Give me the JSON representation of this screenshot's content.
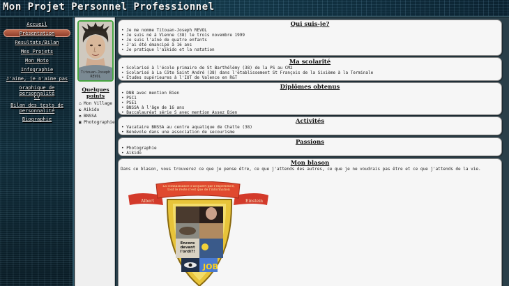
{
  "header": {
    "title": "Mon Projet Personnel Professionnel"
  },
  "nav": {
    "items": [
      {
        "label": "Accueil"
      },
      {
        "label": "Présentation",
        "active": true
      },
      {
        "label": "Resultats/Bilan"
      },
      {
        "label": "Mes Projets"
      },
      {
        "label": "Mon Moto"
      },
      {
        "label": "Infographie"
      },
      {
        "label": "J'aime, je n'aime pas"
      },
      {
        "label": "Graphique de personnalité"
      },
      {
        "label": "CV"
      },
      {
        "label": "Bilan des tests de personnalité"
      },
      {
        "label": "Biographie"
      }
    ]
  },
  "profile": {
    "avatar_caption": "Titouan-Joseph REVOL",
    "interests_title": "Quelques points",
    "interests": [
      {
        "icon": "home-icon",
        "glyph": "⌂",
        "label": "Mon Village"
      },
      {
        "icon": "aikido-icon",
        "glyph": "☯",
        "label": "Aikido"
      },
      {
        "icon": "bnssa-icon",
        "glyph": "✪",
        "label": "BNSSA"
      },
      {
        "icon": "camera-icon",
        "glyph": "▣",
        "label": "Photographie"
      }
    ]
  },
  "sections": {
    "qui": {
      "title": "Qui suis-je?",
      "items": [
        "Je me nomme Titouan-Joseph REVOL",
        "Je suis né à Vienne (38) le trois novembre 1999",
        "Je suis l'aîné de quatre enfants",
        "J'ai été émancipé à 16 ans",
        "Je pratique l'aïkido et la natation"
      ]
    },
    "scolarite": {
      "title": "Ma scolarité",
      "items": [
        "Scolarisé à l'école primaire de St Barthélémy (38) de la PS au CM2",
        "Scolarisé à La Côte Saint André (38) dans l'établissement St François de la Sixième à la Terminale",
        "Études supérieures à l'IUT de Valence en R&T"
      ]
    },
    "diplomes": {
      "title": "Diplômes obtenus",
      "items": [
        "DNB avec mention Bien",
        "PSC1",
        "PSE1",
        "BNSSA à l'âge de 16 ans",
        "Baccalauréat série S avec mention Assez Bien"
      ]
    },
    "activites": {
      "title": "Activités",
      "items": [
        "Vacataire BNSSA au centre aquatique de Chatte (38)",
        "Bénévole dans une association de secourisme"
      ]
    },
    "passions": {
      "title": "Passions",
      "items": [
        "Photographie",
        "Aikido"
      ]
    },
    "blason": {
      "title": "Mon blason",
      "text": "Dans ce blason, vous trouverez ce que je pense être, ce que j'attends des autres, ce que je ne voudrais pas être et ce que j'attends de la vie.",
      "banner_text": "La connaissance s'acquiert par l'expérience, tout le reste n'est que de l'information",
      "left_name": "Albert",
      "right_name": "Einstein",
      "panel_text": "Encore devant l'ordi?!",
      "job_text": "JOB"
    }
  },
  "colors": {
    "active_nav": "#c36a4e",
    "avatar_border": "#46a540",
    "main_bg": "#2a3f49"
  }
}
